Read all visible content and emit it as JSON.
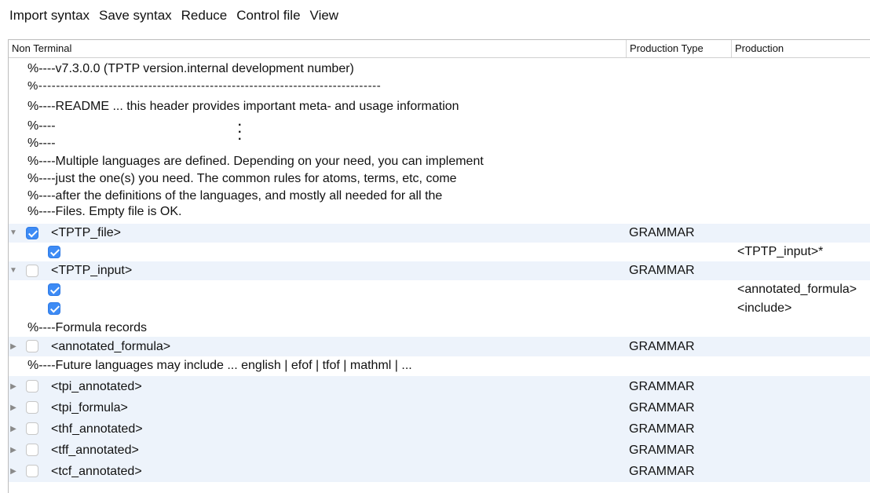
{
  "menu": [
    "Import syntax",
    "Save syntax",
    "Reduce",
    "Control file",
    "View"
  ],
  "columns": {
    "non_terminal": "Non Terminal",
    "production_type": "Production Type",
    "production": "Production"
  },
  "comments": {
    "c1": "%----v7.3.0.0 (TPTP version.internal development number)",
    "c2": "%------------------------------------------------------------------------------",
    "c3": "%----README ... this header provides important meta- and usage information",
    "c4": "%----",
    "c5": "%----",
    "c6": "%----Multiple languages are defined. Depending on your need, you can implement",
    "c7": "%----just the one(s) you need. The common rules for atoms, terms, etc, come",
    "c8": "%----after the definitions of the languages, and mostly all needed for all the",
    "c9": "%----Files. Empty file is OK.",
    "c10": "%----Formula records",
    "c11": "%----Future languages may include ...  english | efof | tfof | mathml | ..."
  },
  "rows": {
    "tptp_file": {
      "name": "<TPTP_file>",
      "type": "GRAMMAR",
      "checked": true,
      "expanded": true
    },
    "tptp_file_p1": {
      "production": "<TPTP_input>*",
      "checked": true
    },
    "tptp_input": {
      "name": "<TPTP_input>",
      "type": "GRAMMAR",
      "checked": false,
      "expanded": true
    },
    "tptp_input_p1": {
      "production": "<annotated_formula>",
      "checked": true
    },
    "tptp_input_p2": {
      "production": "<include>",
      "checked": true
    },
    "annotated_formula": {
      "name": "<annotated_formula>",
      "type": "GRAMMAR",
      "checked": false,
      "expanded": false
    },
    "tpi_annotated": {
      "name": "<tpi_annotated>",
      "type": "GRAMMAR",
      "checked": false,
      "expanded": false
    },
    "tpi_formula": {
      "name": "<tpi_formula>",
      "type": "GRAMMAR",
      "checked": false,
      "expanded": false
    },
    "thf_annotated": {
      "name": "<thf_annotated>",
      "type": "GRAMMAR",
      "checked": false,
      "expanded": false
    },
    "tff_annotated": {
      "name": "<tff_annotated>",
      "type": "GRAMMAR",
      "checked": false,
      "expanded": false
    },
    "tcf_annotated": {
      "name": "<tcf_annotated>",
      "type": "GRAMMAR",
      "checked": false,
      "expanded": false
    }
  },
  "icons": {
    "expanded": "disclosure-triangle-down-icon",
    "collapsed": "disclosure-triangle-right-icon",
    "checked": "checkbox-checked-icon",
    "unchecked": "checkbox-unchecked-icon"
  },
  "colors": {
    "row_highlight": "#edf3fb",
    "checkbox_blue": "#3d8bf5"
  }
}
